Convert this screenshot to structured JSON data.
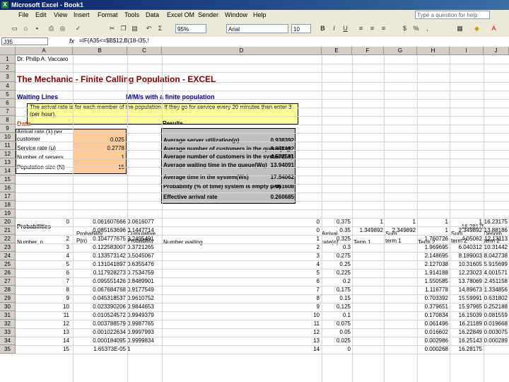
{
  "window": {
    "title": "Microsoft Excel - Book1",
    "app_icon": "X"
  },
  "menu": [
    "File",
    "Edit",
    "View",
    "Insert",
    "Format",
    "Tools",
    "Data",
    "Excel OM",
    "Sender",
    "Window",
    "Help"
  ],
  "ask_placeholder": "Type a question for help",
  "toolbar": {
    "zoom": "95%",
    "font": "Arial",
    "size": "10",
    "sum_icon": "Σ",
    "currency_icon": "$",
    "percent_icon": "%",
    "comma_icon": ","
  },
  "formula": {
    "cell": "J35",
    "fx": "fx",
    "text": "=IF(A35<=$B$12,B(18-I35,!"
  },
  "columns": [
    "A",
    "B",
    "C",
    "D",
    "E",
    "F",
    "G",
    "H",
    "I",
    "J"
  ],
  "rows": [
    "1",
    "2",
    "3",
    "4",
    "5",
    "6",
    "7",
    "8",
    "9",
    "10",
    "11",
    "12",
    "13",
    "14",
    "15",
    "16",
    "17",
    "18",
    "19",
    "20",
    "21",
    "22",
    "23",
    "24",
    "25",
    "26",
    "27",
    "28",
    "29",
    "30",
    "31",
    "32",
    "33",
    "34",
    "35"
  ],
  "sheet": {
    "author": "Dr. Philip A. Vaccaro",
    "title": "The Mechanic - Finite Calling Population - EXCEL",
    "waiting_lines": "Waiting Lines",
    "model": "M/M/s with a finite population",
    "note": "The arrival rate is for each member of the population. If they go for service every 20 minutes then enter 3 (per hour).",
    "data_label": "Data",
    "results_label": "Results",
    "inputs": [
      {
        "label": "Arrival rate (λ) per",
        "value": ""
      },
      {
        "label": "customer",
        "value": "0.025"
      },
      {
        "label": "Service rate (μ)",
        "value": "0.2778"
      },
      {
        "label": "Number of servers",
        "value": "1"
      },
      {
        "label": "Population size (N)",
        "value": "15"
      }
    ],
    "results": [
      {
        "label": "Average server utilization(ρ)",
        "value": "0.938392"
      },
      {
        "label": "Average number of customers in the queue(Lq)",
        "value": "3.634192"
      },
      {
        "label": "Average number of customers in the system(Ls)",
        "value": "4.572581"
      },
      {
        "label": "Average waiting time in the queue(Wq)",
        "value": "13.94091"
      },
      {
        "label": "Average time in the system(Ws)",
        "value": "17.54062"
      },
      {
        "label": "Probability (% of time) system is empty (P0)",
        "value": "0.061608"
      },
      {
        "label": "Effective arrival rate",
        "value": "0.260685"
      }
    ],
    "probabilities_label": "Probabilities",
    "prob_corner": "16.28175",
    "headers": {
      "num": "Number, n",
      "prob1": "Probability",
      "prob2": "P(n)",
      "cum1": "Cumulative",
      "cum2": "Probability",
      "numwait": "Number waiting",
      "arr1": "Arrival",
      "arr2": "rate(n)",
      "term1": "Term 1",
      "sum1a": "Sum",
      "sum1b": "term 1",
      "term2": "Term 2",
      "sum2a": "Sum",
      "sum2b": "term 2",
      "denom1": "Denom",
      "denom2": "term 2"
    },
    "table": [
      [
        "0",
        "0.061607666",
        "0.0616077",
        "0",
        "0.375",
        "1",
        "1",
        "1",
        "1",
        "16.23175"
      ],
      [
        "",
        "0.085163696",
        "0.1447714",
        "0",
        "0.35",
        "1.349892",
        "2.349892",
        "1",
        "2.349892",
        "13.88186"
      ],
      [
        "2",
        "0.104777675",
        "0.2495491",
        "1",
        "0.325",
        "",
        "",
        "1.760726",
        "4.05062",
        "12.13113"
      ],
      [
        "3",
        "0.122583007",
        "0.3721265",
        "2",
        "0.3",
        "",
        "",
        "1.969695",
        "6.040312",
        "10.31442"
      ],
      [
        "4",
        "0.133573142",
        "0.5045067",
        "3",
        "0.275",
        "",
        "",
        "2.148695",
        "8.189003",
        "8.042738"
      ],
      [
        "5",
        "0.131041897",
        "0.6355476",
        "4",
        "0.25",
        "",
        "",
        "2.127038",
        "10.31605",
        "5.915699"
      ],
      [
        "6",
        "0.117928273",
        "0.7534759",
        "5",
        "0.225",
        "",
        "",
        "1.914188",
        "12.23023",
        "4.001571"
      ],
      [
        "7",
        "0.095551426",
        "0.8489901",
        "6",
        "0.2",
        "",
        "",
        "1.550585",
        "13.78069",
        "2.451158"
      ],
      [
        "8",
        "0.067684768",
        "0.9177549",
        "7",
        "0.175",
        "",
        "",
        "1.116778",
        "14.89673",
        "1.334856"
      ],
      [
        "9",
        "0.045318537",
        "0.9610752",
        "8",
        "0.15",
        "",
        "",
        "0.703392",
        "15.59991",
        "0.631802"
      ],
      [
        "10",
        "0.023390206",
        "0.9844653",
        "9",
        "0.125",
        "",
        "",
        "0.379651",
        "15.97965",
        "0.252188"
      ],
      [
        "11",
        "0.010524572",
        "0.9949379",
        "10",
        "0.1",
        "",
        "",
        "0.170834",
        "16.15039",
        "0.081559"
      ],
      [
        "12",
        "0.003788579",
        "0.9987765",
        "11",
        "0.075",
        "",
        "",
        "0.061496",
        "16.21189",
        "0.019668"
      ],
      [
        "13",
        "0.001022634",
        "0.9997993",
        "12",
        "0.05",
        "",
        "",
        "0.016602",
        "16.22849",
        "0.003075"
      ],
      [
        "14",
        "0.000184095",
        "0.9999834",
        "13",
        "0.025",
        "",
        "",
        "0.002986",
        "16.25143",
        "0.000289"
      ],
      [
        "15",
        "1.65373E-05",
        "1",
        "14",
        "0",
        "",
        "",
        "0.000268",
        "16.28175",
        ""
      ]
    ]
  }
}
